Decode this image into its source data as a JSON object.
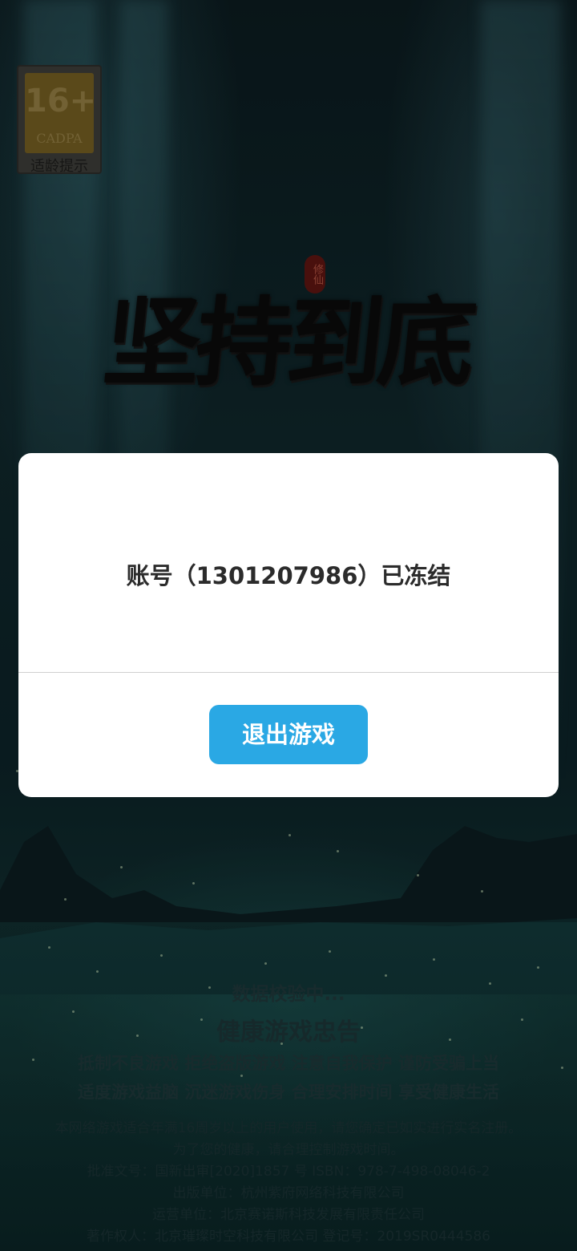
{
  "age_badge": {
    "rating": "16+",
    "org": "CADPA",
    "hint": "适龄提示"
  },
  "game": {
    "title": "坚持到底",
    "seal": "修仙"
  },
  "dialog": {
    "message": "账号（1301207986）已冻结",
    "exit_label": "退出游戏"
  },
  "footer": {
    "loading_status": "数据校验中...",
    "health_title": "健康游戏忠告",
    "slogans": [
      "抵制不良游戏  拒绝盗版游戏  注意自我保护  谨防受骗上当",
      "适度游戏益脑  沉迷游戏伤身  合理安排时间  享受健康生活"
    ],
    "info_lines": [
      "本网络游戏适合年满16周岁以上的用户使用，请您确定已如实进行实名注册。",
      "为了您的健康，请合理控制游戏时间。",
      "批准文号：国新出审[2020]1857 号   ISBN：978-7-498-08046-2",
      "出版单位：杭州紫府网络科技有限公司",
      "运营单位：北京赛诺斯科技发展有限责任公司",
      "著作权人：北京璀璨时空科技有限公司  登记号：2019SR0444586"
    ]
  },
  "colors": {
    "button": "#2aa8e4",
    "dialog_bg": "#ffffff",
    "text_dark": "#2b2b2b"
  }
}
